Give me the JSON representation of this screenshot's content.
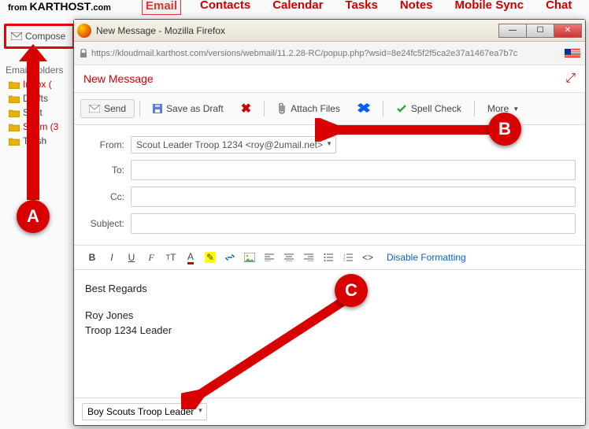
{
  "brand_prefix": "from ",
  "brand_main": "KARTHOST",
  "brand_suffix": ".com",
  "topnav": {
    "items": [
      "Email",
      "Contacts",
      "Calendar",
      "Tasks",
      "Notes",
      "Mobile Sync",
      "Chat"
    ]
  },
  "compose_label": "Compose",
  "folders_heading": "Email Folders",
  "folders": [
    {
      "label": "Inbox (",
      "red": true
    },
    {
      "label": "Drafts",
      "red": false
    },
    {
      "label": "Sent",
      "red": false
    },
    {
      "label": "Spam (3",
      "red": true
    },
    {
      "label": "Trash",
      "red": false
    }
  ],
  "window_title": "New Message - Mozilla Firefox",
  "url": "https://kloudmail.karthost.com/versions/webmail/11.2.28-RC/popup.php?wsid=8e24fc5f2f5ca2e37a1467ea7b7c",
  "new_message_label": "New Message",
  "send_label": "Send",
  "save_draft_label": "Save as Draft",
  "attach_label": "Attach Files",
  "spell_label": "Spell Check",
  "more_label": "More",
  "field": {
    "from": "From:",
    "to": "To:",
    "cc": "Cc:",
    "subject": "Subject:"
  },
  "from_value": "Scout Leader Troop 1234 <roy@2umail.net>",
  "disable_fmt": "Disable Formatting",
  "body": {
    "line1": "Best Regards",
    "line2": "Roy Jones",
    "line3": "Troop 1234 Leader"
  },
  "signature_value": "Boy Scouts Troop Leader",
  "callouts": {
    "a": "A",
    "b": "B",
    "c": "C"
  }
}
